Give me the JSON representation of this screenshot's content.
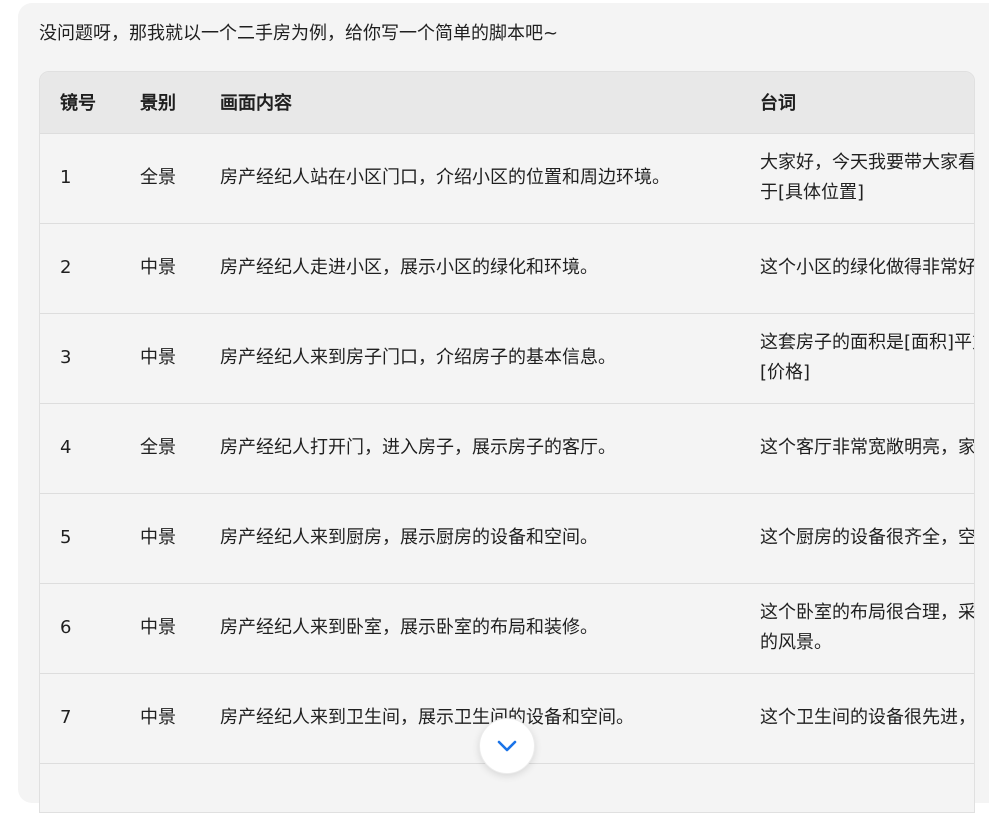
{
  "message": {
    "intro": "没问题呀，那我就以一个二手房为例，给你写一个简单的脚本吧~"
  },
  "table": {
    "headers": [
      "镜号",
      "景别",
      "画面内容",
      "台词"
    ],
    "rows": [
      {
        "no": "1",
        "shot": "全景",
        "content": "房产经纪人站在小区门口，介绍小区的位置和周边环境。",
        "line": "大家好，今天我要带大家看的房子在这个小区，这个小区位于[具体位置]"
      },
      {
        "no": "2",
        "shot": "中景",
        "content": "房产经纪人走进小区，展示小区的绿化和环境。",
        "line": "这个小区的绿化做得非常好，环境优美，非常适合居住。"
      },
      {
        "no": "3",
        "shot": "中景",
        "content": "房产经纪人来到房子门口，介绍房子的基本信息。",
        "line": "这套房子的面积是[面积]平方米，有[房间数]个房间，价格是[价格]"
      },
      {
        "no": "4",
        "shot": "全景",
        "content": "房产经纪人打开门，进入房子，展示房子的客厅。",
        "line": "这个客厅非常宽敞明亮，家具家电一应俱全。"
      },
      {
        "no": "5",
        "shot": "中景",
        "content": "房产经纪人来到厨房，展示厨房的设备和空间。",
        "line": "这个厨房的设备很齐全，空间足够满足日常需求。"
      },
      {
        "no": "6",
        "shot": "中景",
        "content": "房产经纪人来到卧室，展示卧室的布局和装修。",
        "line": "这个卧室的布局很合理，采光很好，站在窗边可以看到外面的风景。"
      },
      {
        "no": "7",
        "shot": "中景",
        "content": "房产经纪人来到卫生间，展示卫生间的设备和空间。",
        "line": "这个卫生间的设备很先进，还有浴缸，可以泡个舒服的澡。"
      }
    ]
  },
  "controls": {
    "scroll_down_icon": "chevron-down-icon",
    "accent_color": "#1a73e8"
  }
}
